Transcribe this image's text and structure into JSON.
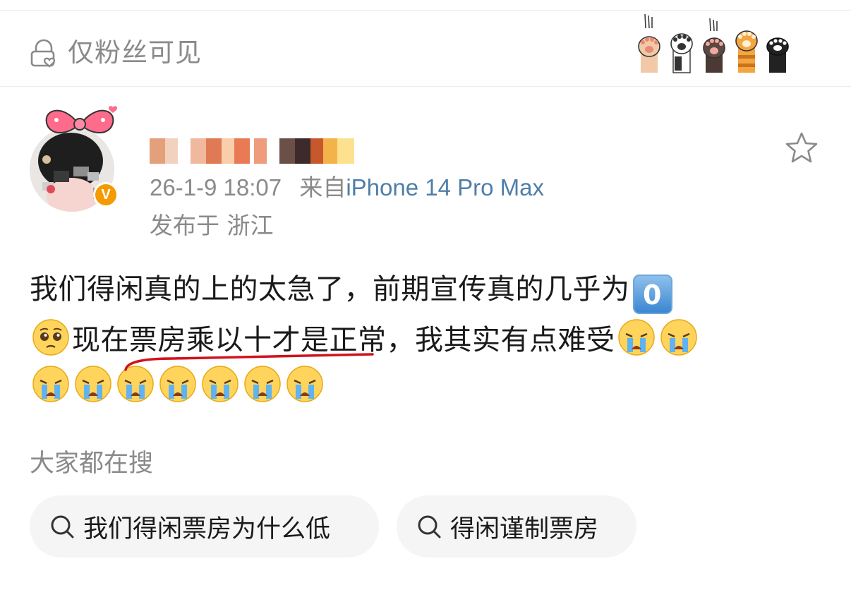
{
  "visibility": {
    "label": "仅粉丝可见"
  },
  "post": {
    "timestamp": "26-1-9 18:07",
    "source_prefix": "来自",
    "device": "iPhone 14 Pro Max",
    "location": "发布于 浙江",
    "text_line1": "我们得闲真的上的太急了，前期宣传真的几乎为",
    "text_line2": "现在票房乘以十才是正常，我其实有点难受"
  },
  "search": {
    "title": "大家都在搜",
    "chips": [
      {
        "label": "我们得闲票房为什么低"
      },
      {
        "label": "得闲谨制票房"
      }
    ]
  },
  "icons": {
    "lock": "lock-heart-icon",
    "star": "star-outline-icon",
    "search": "search-icon",
    "verified": "verified-v-badge-icon"
  },
  "colors": {
    "gray_text": "#8a8a8a",
    "device_link": "#4f7ea8",
    "verified_badge": "#f59a00",
    "underline": "#d0121b"
  },
  "badge_text": "V",
  "zero_key": "0"
}
